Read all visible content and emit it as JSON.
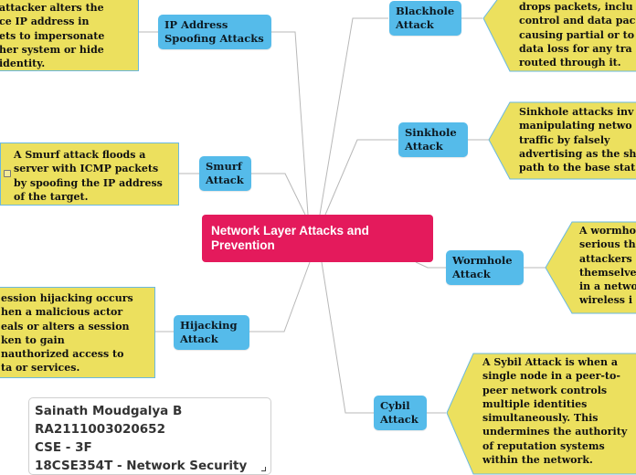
{
  "root": {
    "label": "Network Layer Attacks and Prevention"
  },
  "topics": {
    "ip_spoofing": {
      "label_lines": [
        "IP Address",
        "Spoofing Attacks"
      ],
      "note_lines": [
        "attacker alters the",
        "ce IP address in",
        "ets to impersonate",
        "her system or hide",
        "identity."
      ]
    },
    "smurf": {
      "label_lines": [
        "Smurf",
        "Attack"
      ],
      "note_lines": [
        "A Smurf attack floods a",
        "server with ICMP packets",
        "by spoofing the IP address",
        "of the target."
      ]
    },
    "hijacking": {
      "label_lines": [
        "Hijacking",
        "Attack"
      ],
      "note_lines": [
        "ession hijacking occurs",
        "hen a malicious actor",
        "eals or alters a session",
        "ken to gain",
        "nauthorized access to",
        "ta or services."
      ]
    },
    "blackhole": {
      "label_lines": [
        "Blackhole",
        "Attack"
      ],
      "note_lines": [
        "drops packets, inclu",
        "control and data pac",
        "causing partial or to",
        "data loss for any tra",
        "routed through it."
      ]
    },
    "sinkhole": {
      "label_lines": [
        "Sinkhole",
        "Attack"
      ],
      "note_lines": [
        "Sinkhole attacks inv",
        "manipulating netwo",
        "traffic by falsely",
        "advertising as the sh",
        "path to the base stat"
      ]
    },
    "wormhole": {
      "label_lines": [
        "Wormhole",
        "Attack"
      ],
      "note_lines": [
        "A wormho",
        "serious th",
        "attackers",
        "themselve",
        "in a netwo",
        "wireless i"
      ]
    },
    "cybil": {
      "label_lines": [
        "Cybil",
        "Attack"
      ],
      "note_lines": [
        "A Sybil Attack is when a",
        "single node in a peer-to-",
        "peer network controls",
        "multiple identities",
        "simultaneously. This",
        "undermines the authority",
        "of reputation systems",
        "within the network."
      ]
    }
  },
  "info_box": {
    "lines": [
      "Sainath Moudgalya B",
      "RA2111003020652",
      "CSE - 3F",
      "18CSE354T - Network Security"
    ]
  },
  "colors": {
    "root": "#e41a5c",
    "topic": "#55bbea",
    "note": "#ece05e",
    "note_border": "#6ab8e0",
    "connector": "#b8b8b8"
  }
}
